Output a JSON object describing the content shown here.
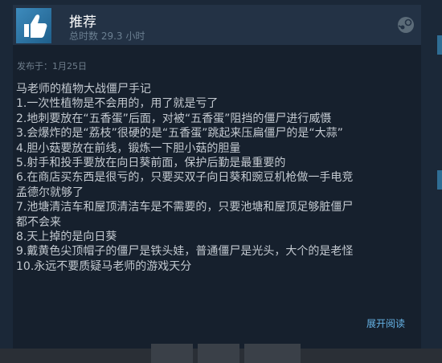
{
  "review": {
    "title": "推荐",
    "hours": "总时数 29.3 小时",
    "date": "发布于：1月25日",
    "lines": [
      "马老师的植物大战僵尸手记",
      "1.一次性植物是不会用的，用了就是亏了",
      "2.地刺要放在“五香蛋”后面，对被“五香蛋”阻挡的僵尸进行威慑",
      "3.会爆炸的是“荔枝”很硬的是“五香蛋”跳起来压扁僵尸的是“大蒜”",
      "4.胆小菇要放在前线，锻炼一下胆小菇的胆量",
      "5.射手和投手要放在向日葵前面，保护后勤是最重要的",
      "6.在商店买东西是很亏的，只要买双子向日葵和豌豆机枪做一手电竞",
      "孟德尔就够了",
      "7.池塘清洁车和屋顶清洁车是不需要的，只要池塘和屋顶足够脏僵尸",
      "都不会来",
      "8.天上掉的是向日葵",
      "9.戴黄色尖顶帽子的僵尸是铁头娃，普通僵尸是光头，大个的是老怪",
      "10.永远不要质疑马老师的游戏天分"
    ],
    "expand_label": "展开阅读"
  },
  "colors": {
    "background": "#1b2838",
    "card": "#16202d",
    "header": "#233245",
    "text": "#c3c9d0",
    "link": "#66b3e6"
  },
  "icons": {
    "thumb": "thumbs-up-icon",
    "platform": "steam-logo-icon"
  }
}
